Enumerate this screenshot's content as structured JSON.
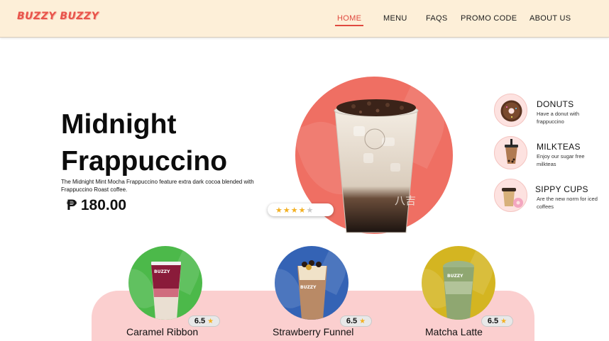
{
  "brand": {
    "logo": "BUZZY BUZZY"
  },
  "nav": {
    "items": [
      {
        "label": "HOME",
        "active": true
      },
      {
        "label": "MENU"
      },
      {
        "label": "FAQS"
      },
      {
        "label": "PROMO CODE"
      },
      {
        "label": "ABOUT US"
      }
    ]
  },
  "hero": {
    "title_line1": "Midnight",
    "title_line2": "Frappuccino",
    "description": "The Midnight Mint Mocha Frappuccino feature extra dark cocoa blended  with Frappuccino Roast coffee.",
    "price": "₱ 180.00",
    "rating_stars": 4.5,
    "circle_color": "#ef6f63"
  },
  "categories": [
    {
      "title": "DONUTS",
      "desc": "Have a  donut with frappuccino",
      "icon": "donut-icon"
    },
    {
      "title": "MILKTEAS",
      "desc": "Enjoy our sugar free milkteas",
      "icon": "milktea-icon"
    },
    {
      "title": "SIPPY CUPS",
      "desc": "Are the new norm for iced coffees",
      "icon": "sippy-cup-icon"
    }
  ],
  "products": [
    {
      "name": "Caramel Ribbon",
      "rating": "6.5",
      "color": "#4cb94a"
    },
    {
      "name": "Strawberry Funnel",
      "rating": "6.5",
      "color": "#3463b5"
    },
    {
      "name": "Matcha Latte",
      "rating": "6.5",
      "color": "#d4b521"
    }
  ],
  "colors": {
    "accent": "#e0493f",
    "nav_bg": "#fdefd8",
    "panel_pink": "#fbcfcf"
  }
}
